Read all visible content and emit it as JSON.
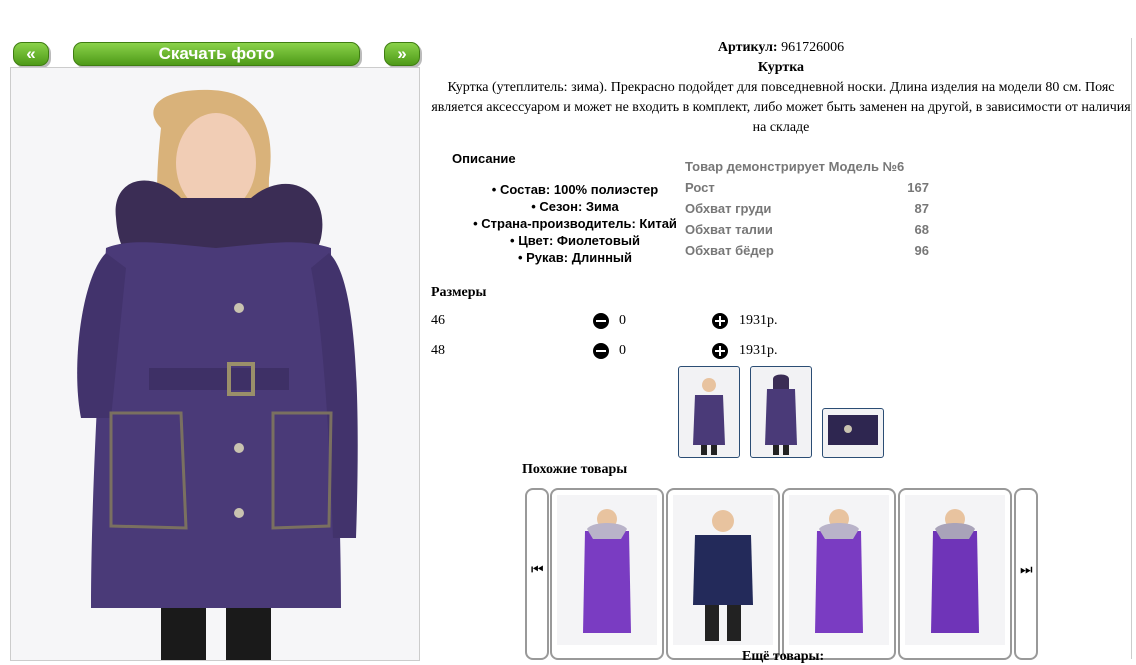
{
  "gallery": {
    "prev_label": "«",
    "download_label": "Скачать фото",
    "next_label": "»"
  },
  "product": {
    "article_label": "Артикул:",
    "article_value": "961726006",
    "name": "Куртка",
    "description": "Куртка (утеплитель: зима). Прекрасно подойдет для повседневной носки. Длина изделия на модели 80 см. Пояс является аксессуаром и может не входить в комплект, либо может быть заменен на другой, в зависимости от наличия на складе",
    "specs_title": "Описание",
    "specs": [
      "Состав: 100% полиэстер",
      "Сезон: Зима",
      "Страна-производитель: Китай",
      "Цвет: Фиолетовый",
      "Рукав: Длинный"
    ],
    "model_title": "Товар демонстрирует Модель №6",
    "model_rows": [
      {
        "label": "Рост",
        "value": "167"
      },
      {
        "label": "Обхват груди",
        "value": "87"
      },
      {
        "label": "Обхват талии",
        "value": "68"
      },
      {
        "label": "Обхват бёдер",
        "value": "96"
      }
    ],
    "sizes_title": "Размеры",
    "sizes": [
      {
        "size": "46",
        "qty": "0",
        "price": "1931р."
      },
      {
        "size": "48",
        "qty": "0",
        "price": "1931р."
      }
    ]
  },
  "similar": {
    "title": "Похожие товары",
    "prev_icon": "skip-back-icon",
    "next_icon": "skip-forward-icon",
    "prev_glyph": "⏮",
    "next_glyph": "⏭"
  },
  "more_title": "Ещё товары:",
  "colors": {
    "button_green": "#5fae24",
    "jacket_purple": "#4a3a78",
    "bright_purple": "#7a3cc2",
    "navy": "#232a5a",
    "thumb_border": "#2b4d74"
  }
}
